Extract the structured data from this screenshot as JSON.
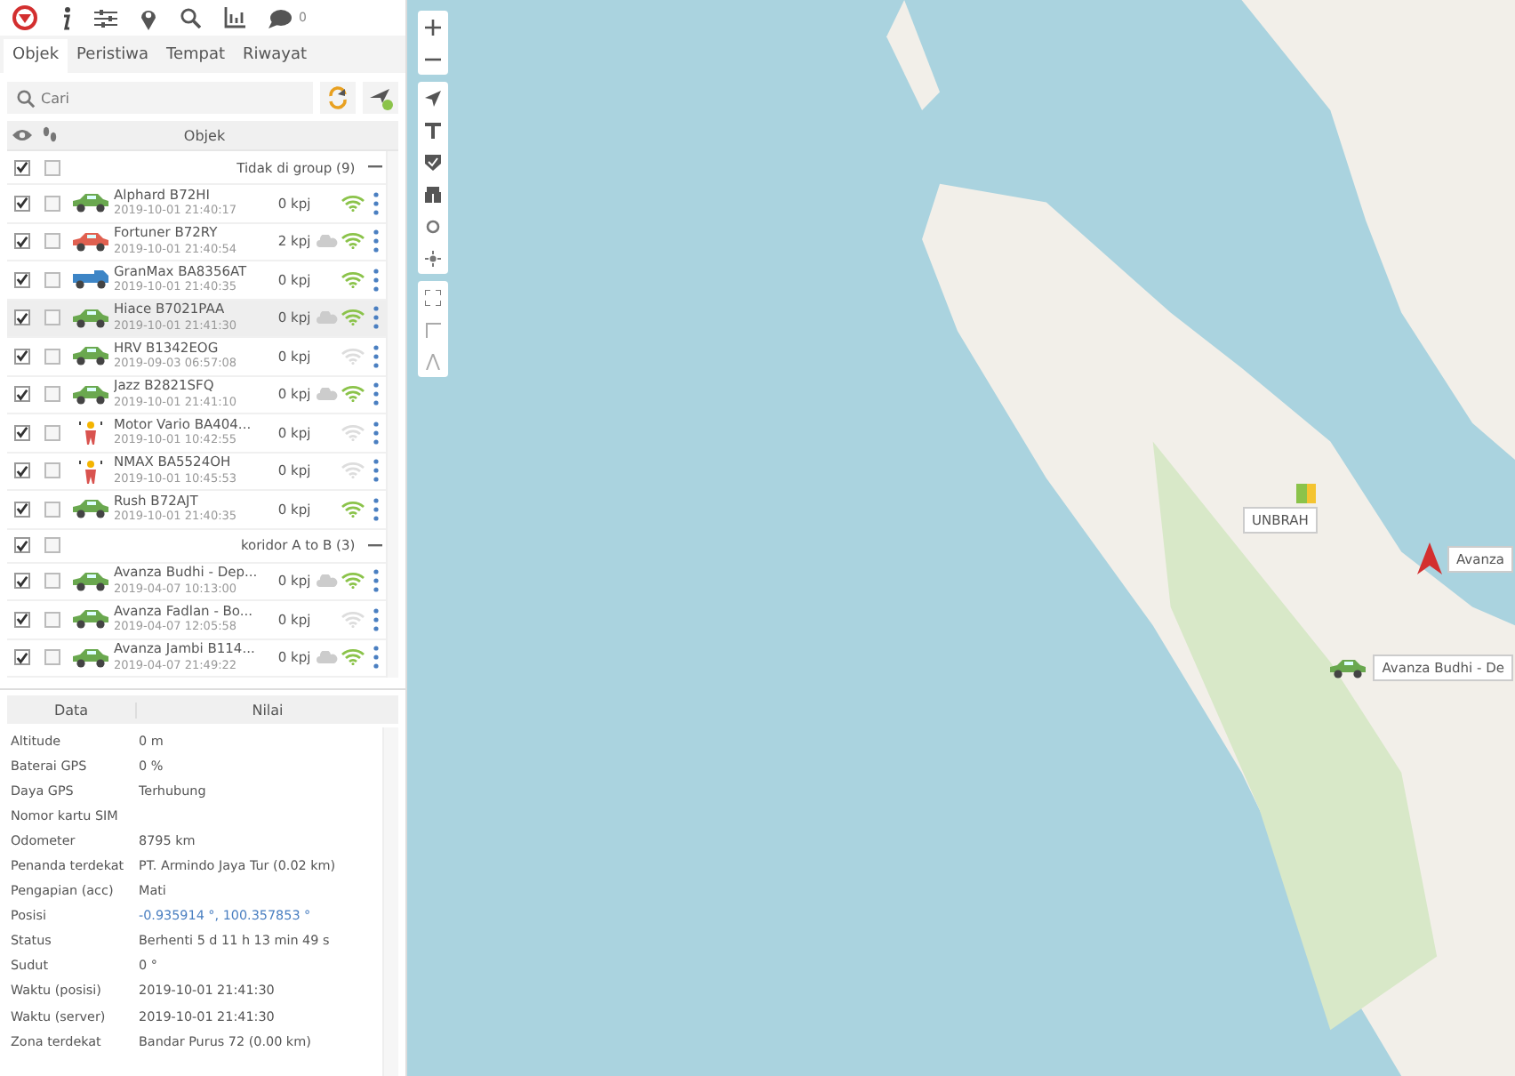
{
  "toolbar": {
    "badge": "0"
  },
  "tabs": [
    {
      "label": "Objek",
      "selected": true
    },
    {
      "label": "Peristiwa",
      "selected": false
    },
    {
      "label": "Tempat",
      "selected": false
    },
    {
      "label": "Riwayat",
      "selected": false
    }
  ],
  "search": {
    "placeholder": "Cari"
  },
  "list_header": {
    "column": "Objek"
  },
  "groups": [
    {
      "name": "Tidak di group (9)",
      "visible": true,
      "followed": false,
      "items": [
        {
          "name": "Alphard B72HI",
          "time": "2019-10-01 21:40:17",
          "speed": "0 kpj",
          "kind": "car",
          "color": "#6aa84f",
          "visible": true,
          "followed": false,
          "cloud": false,
          "signal": true,
          "selected": false
        },
        {
          "name": "Fortuner B72RY",
          "time": "2019-10-01 21:40:54",
          "speed": "2 kpj",
          "kind": "car",
          "color": "#e06050",
          "visible": true,
          "followed": false,
          "cloud": true,
          "signal": true,
          "selected": false
        },
        {
          "name": "GranMax BA8356AT",
          "time": "2019-10-01 21:40:35",
          "speed": "0 kpj",
          "kind": "truck",
          "color": "#3d85c6",
          "visible": true,
          "followed": false,
          "cloud": false,
          "signal": true,
          "selected": false
        },
        {
          "name": "Hiace B7021PAA",
          "time": "2019-10-01 21:41:30",
          "speed": "0 kpj",
          "kind": "car",
          "color": "#6aa84f",
          "visible": true,
          "followed": false,
          "cloud": true,
          "signal": true,
          "selected": true
        },
        {
          "name": "HRV B1342EOG",
          "time": "2019-09-03 06:57:08",
          "speed": "0 kpj",
          "kind": "car",
          "color": "#6aa84f",
          "visible": true,
          "followed": false,
          "cloud": false,
          "signal": false,
          "selected": false
        },
        {
          "name": "Jazz B2821SFQ",
          "time": "2019-10-01 21:41:10",
          "speed": "0 kpj",
          "kind": "car",
          "color": "#6aa84f",
          "visible": true,
          "followed": false,
          "cloud": true,
          "signal": true,
          "selected": false
        },
        {
          "name": "Motor Vario BA404...",
          "time": "2019-10-01 10:42:55",
          "speed": "0 kpj",
          "kind": "motorbike",
          "color": "#d9534f",
          "visible": true,
          "followed": false,
          "cloud": false,
          "signal": false,
          "selected": false
        },
        {
          "name": "NMAX BA5524OH",
          "time": "2019-10-01 10:45:53",
          "speed": "0 kpj",
          "kind": "motorbike",
          "color": "#d9534f",
          "visible": true,
          "followed": false,
          "cloud": false,
          "signal": false,
          "selected": false
        },
        {
          "name": "Rush B72AJT",
          "time": "2019-10-01 21:40:35",
          "speed": "0 kpj",
          "kind": "car",
          "color": "#6aa84f",
          "visible": true,
          "followed": false,
          "cloud": false,
          "signal": true,
          "selected": false
        }
      ]
    },
    {
      "name": "koridor A to B (3)",
      "visible": true,
      "followed": false,
      "items": [
        {
          "name": "Avanza Budhi - Dep...",
          "time": "2019-04-07 10:13:00",
          "speed": "0 kpj",
          "kind": "car",
          "color": "#6aa84f",
          "visible": true,
          "followed": false,
          "cloud": true,
          "signal": true,
          "selected": false
        },
        {
          "name": "Avanza Fadlan - Bo...",
          "time": "2019-04-07 12:05:58",
          "speed": "0 kpj",
          "kind": "car",
          "color": "#6aa84f",
          "visible": true,
          "followed": false,
          "cloud": false,
          "signal": false,
          "selected": false
        },
        {
          "name": "Avanza Jambi B114...",
          "time": "2019-04-07 21:49:22",
          "speed": "0 kpj",
          "kind": "car",
          "color": "#6aa84f",
          "visible": true,
          "followed": false,
          "cloud": true,
          "signal": true,
          "selected": false
        }
      ]
    }
  ],
  "details": {
    "columns": [
      "Data",
      "Nilai"
    ],
    "rows": [
      {
        "label": "Altitude",
        "value": "0 m"
      },
      {
        "label": "Baterai GPS",
        "value": "0 %"
      },
      {
        "label": "Daya GPS",
        "value": "Terhubung"
      },
      {
        "label": "Nomor kartu SIM"
      },
      {
        "label": "Odometer",
        "value": "8795 km"
      },
      {
        "label": "Penanda terdekat",
        "value": "PT. Armindo Jaya Tur (0.02 km)"
      },
      {
        "label": "Pengapian (acc)",
        "value": "Mati"
      },
      {
        "label": "Posisi",
        "value": "-0.935914 °, 100.357853 °",
        "kind": "link"
      },
      {
        "label": "Status",
        "value": "Berhenti 5 d 11 h 13 min 49 s"
      },
      {
        "label": "Sudut",
        "value": "0 °"
      },
      {
        "label": "Waktu (posisi)",
        "value": "2019-10-01 21:41:30"
      },
      {
        "label": "Waktu (server)",
        "value": "2019-10-01 21:41:30"
      },
      {
        "label": "Zona terdekat",
        "value": "Bandar Purus 72 (0.00 km)"
      }
    ]
  },
  "map": {
    "markers": [
      {
        "kind": "zone",
        "label": "UNBRAH"
      },
      {
        "kind": "arrow",
        "label": "Avanza"
      },
      {
        "kind": "car",
        "label": "Avanza Budhi - De"
      }
    ]
  }
}
